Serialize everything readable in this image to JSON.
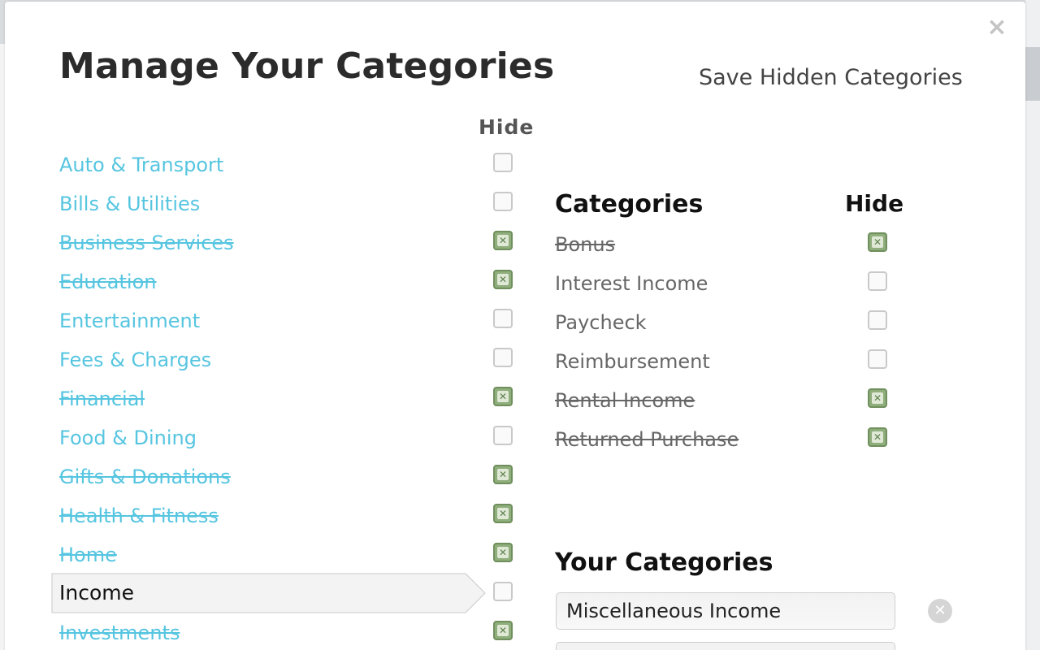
{
  "modal": {
    "title": "Manage Your Categories",
    "save_link": "Save Hidden Categories",
    "close_icon": "×"
  },
  "left": {
    "hide_header": "Hide",
    "categories": [
      {
        "label": "Auto & Transport",
        "hidden": false
      },
      {
        "label": "Bills & Utilities",
        "hidden": false
      },
      {
        "label": "Business Services",
        "hidden": true
      },
      {
        "label": "Education",
        "hidden": true
      },
      {
        "label": "Entertainment",
        "hidden": false
      },
      {
        "label": "Fees & Charges",
        "hidden": false
      },
      {
        "label": "Financial",
        "hidden": true
      },
      {
        "label": "Food & Dining",
        "hidden": false
      },
      {
        "label": "Gifts & Donations",
        "hidden": true
      },
      {
        "label": "Health & Fitness",
        "hidden": true
      },
      {
        "label": "Home",
        "hidden": true
      },
      {
        "label": "Income",
        "hidden": false,
        "selected": true
      },
      {
        "label": "Investments",
        "hidden": true
      }
    ]
  },
  "right": {
    "subcat_title": "Categories",
    "hide_header": "Hide",
    "subcategories": [
      {
        "label": "Bonus",
        "hidden": true
      },
      {
        "label": "Interest Income",
        "hidden": false
      },
      {
        "label": "Paycheck",
        "hidden": false
      },
      {
        "label": "Reimbursement",
        "hidden": false
      },
      {
        "label": "Rental Income",
        "hidden": true
      },
      {
        "label": "Returned Purchase",
        "hidden": true
      }
    ],
    "your_title": "Your Categories",
    "custom": [
      {
        "value": "Miscellaneous Income"
      },
      {
        "value": ""
      }
    ],
    "remove_icon": "x-circle-icon"
  },
  "colors": {
    "link": "#56c5e0",
    "checked": "#8fae7c"
  }
}
